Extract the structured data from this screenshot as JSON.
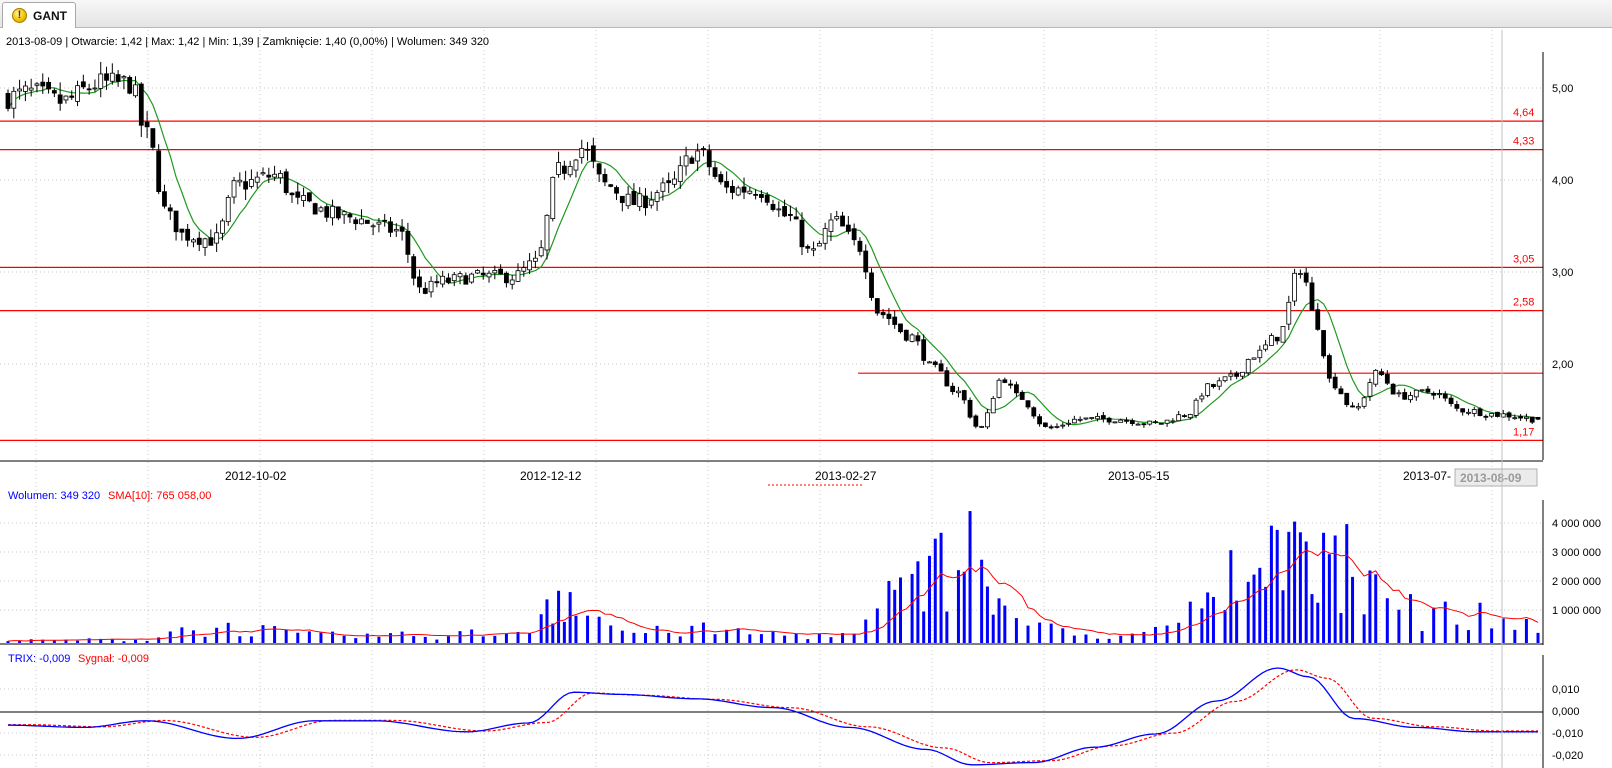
{
  "tab": {
    "label": "GANT",
    "icon": "warning-icon"
  },
  "colors": {
    "candle": "#000000",
    "ma": "#1f9a1f",
    "levels": "#ff0000",
    "volume": "#0000ff",
    "volume_sma": "#ff0000",
    "trix": "#0000ff",
    "signal": "#ff0000",
    "grid": "#c8c8c8"
  },
  "price_panel": {
    "info_line": "2013-08-09 | Otwarcie: 1,42 | Max: 1,42 | Min: 1,39 | Zamknięcie: 1,40 (0,00%)  | Wolumen: 349 320",
    "y_ticks": [
      "5,00",
      "4,00",
      "3,00",
      "2,00"
    ],
    "level_labels": [
      "4,64",
      "4,33",
      "3,05",
      "2,58",
      "1,17"
    ],
    "x_ticks": [
      "2012-10-02",
      "2012-12-12",
      "2013-02-27",
      "2013-05-15",
      "2013-07-"
    ],
    "cursor_date": "2013-08-09"
  },
  "volume_panel": {
    "legend_volume": "Wolumen: 349 320",
    "legend_sma": "SMA[10]: 765 058,00",
    "y_ticks": [
      "4 000 000",
      "3 000 000",
      "2 000 000",
      "1 000 000"
    ]
  },
  "trix_panel": {
    "legend_trix": "TRIX: -0,009",
    "legend_signal": "Sygnał: -0,009",
    "y_ticks": [
      "0,010",
      "0,000",
      "-0,010",
      "-0,020"
    ]
  },
  "chart_data": [
    {
      "type": "candlestick",
      "title": "",
      "x_range": [
        "2012-07",
        "2013-08-09"
      ],
      "ylim": [
        1.1,
        5.4
      ],
      "grid": true,
      "horizontal_levels": [
        4.64,
        4.33,
        3.05,
        2.58,
        1.9,
        1.17
      ],
      "last_candle": {
        "date": "2013-08-09",
        "open": 1.42,
        "high": 1.42,
        "low": 1.39,
        "close": 1.4,
        "change_pct": 0.0,
        "volume": 349320
      },
      "close_path": [
        {
          "t": 0.0,
          "v": 4.9
        },
        {
          "t": 0.015,
          "v": 4.95
        },
        {
          "t": 0.035,
          "v": 4.85
        },
        {
          "t": 0.06,
          "v": 5.05
        },
        {
          "t": 0.08,
          "v": 5.05
        },
        {
          "t": 0.09,
          "v": 4.5
        },
        {
          "t": 0.105,
          "v": 3.6
        },
        {
          "t": 0.115,
          "v": 3.4
        },
        {
          "t": 0.135,
          "v": 3.35
        },
        {
          "t": 0.15,
          "v": 3.95
        },
        {
          "t": 0.175,
          "v": 4.05
        },
        {
          "t": 0.19,
          "v": 3.75
        },
        {
          "t": 0.22,
          "v": 3.6
        },
        {
          "t": 0.255,
          "v": 3.45
        },
        {
          "t": 0.27,
          "v": 2.8
        },
        {
          "t": 0.285,
          "v": 2.9
        },
        {
          "t": 0.305,
          "v": 2.95
        },
        {
          "t": 0.33,
          "v": 2.95
        },
        {
          "t": 0.345,
          "v": 3.1
        },
        {
          "t": 0.36,
          "v": 4.1
        },
        {
          "t": 0.375,
          "v": 4.35
        },
        {
          "t": 0.39,
          "v": 3.95
        },
        {
          "t": 0.41,
          "v": 3.75
        },
        {
          "t": 0.43,
          "v": 3.9
        },
        {
          "t": 0.45,
          "v": 4.3
        },
        {
          "t": 0.47,
          "v": 3.9
        },
        {
          "t": 0.49,
          "v": 3.9
        },
        {
          "t": 0.51,
          "v": 3.6
        },
        {
          "t": 0.525,
          "v": 3.2
        },
        {
          "t": 0.54,
          "v": 3.55
        },
        {
          "t": 0.555,
          "v": 3.3
        },
        {
          "t": 0.57,
          "v": 2.55
        },
        {
          "t": 0.59,
          "v": 2.3
        },
        {
          "t": 0.605,
          "v": 1.95
        },
        {
          "t": 0.62,
          "v": 1.7
        },
        {
          "t": 0.635,
          "v": 1.3
        },
        {
          "t": 0.65,
          "v": 1.85
        },
        {
          "t": 0.66,
          "v": 1.65
        },
        {
          "t": 0.68,
          "v": 1.3
        },
        {
          "t": 0.7,
          "v": 1.4
        },
        {
          "t": 0.725,
          "v": 1.4
        },
        {
          "t": 0.75,
          "v": 1.35
        },
        {
          "t": 0.77,
          "v": 1.45
        },
        {
          "t": 0.785,
          "v": 1.75
        },
        {
          "t": 0.8,
          "v": 1.85
        },
        {
          "t": 0.815,
          "v": 2.1
        },
        {
          "t": 0.83,
          "v": 2.3
        },
        {
          "t": 0.845,
          "v": 3.05
        },
        {
          "t": 0.855,
          "v": 2.45
        },
        {
          "t": 0.865,
          "v": 1.8
        },
        {
          "t": 0.88,
          "v": 1.5
        },
        {
          "t": 0.895,
          "v": 1.9
        },
        {
          "t": 0.91,
          "v": 1.65
        },
        {
          "t": 0.93,
          "v": 1.7
        },
        {
          "t": 0.95,
          "v": 1.5
        },
        {
          "t": 0.975,
          "v": 1.45
        },
        {
          "t": 1.0,
          "v": 1.4
        }
      ]
    },
    {
      "type": "bar",
      "title": "",
      "series": [
        {
          "name": "Wolumen",
          "values_last": 349320
        },
        {
          "name": "SMA[10]",
          "values_last": 765058
        }
      ],
      "ylim": [
        0,
        4600000
      ],
      "volume_profile": [
        {
          "t": 0.0,
          "v": 80000
        },
        {
          "t": 0.09,
          "v": 120000
        },
        {
          "t": 0.11,
          "v": 450000
        },
        {
          "t": 0.15,
          "v": 500000
        },
        {
          "t": 0.2,
          "v": 250000
        },
        {
          "t": 0.26,
          "v": 250000
        },
        {
          "t": 0.33,
          "v": 350000
        },
        {
          "t": 0.36,
          "v": 1300000
        },
        {
          "t": 0.38,
          "v": 900000
        },
        {
          "t": 0.41,
          "v": 350000
        },
        {
          "t": 0.45,
          "v": 450000
        },
        {
          "t": 0.5,
          "v": 300000
        },
        {
          "t": 0.55,
          "v": 250000
        },
        {
          "t": 0.58,
          "v": 1500000
        },
        {
          "t": 0.61,
          "v": 2600000
        },
        {
          "t": 0.635,
          "v": 2000000
        },
        {
          "t": 0.66,
          "v": 800000
        },
        {
          "t": 0.7,
          "v": 250000
        },
        {
          "t": 0.74,
          "v": 300000
        },
        {
          "t": 0.76,
          "v": 450000
        },
        {
          "t": 0.78,
          "v": 1200000
        },
        {
          "t": 0.8,
          "v": 1400000
        },
        {
          "t": 0.83,
          "v": 2800000
        },
        {
          "t": 0.86,
          "v": 2500000
        },
        {
          "t": 0.89,
          "v": 2200000
        },
        {
          "t": 0.91,
          "v": 1500000
        },
        {
          "t": 0.93,
          "v": 900000
        },
        {
          "t": 0.95,
          "v": 1000000
        },
        {
          "t": 0.97,
          "v": 800000
        },
        {
          "t": 1.0,
          "v": 600000
        }
      ],
      "peaks": [
        {
          "t": 0.61,
          "v": 3800000
        },
        {
          "t": 0.63,
          "v": 4550000
        },
        {
          "t": 0.8,
          "v": 3200000
        },
        {
          "t": 0.83,
          "v": 3900000
        },
        {
          "t": 0.86,
          "v": 3800000
        },
        {
          "t": 0.875,
          "v": 4100000
        },
        {
          "t": 0.85,
          "v": 3500000
        },
        {
          "t": 0.89,
          "v": 2500000
        }
      ]
    },
    {
      "type": "line",
      "title": "",
      "series": [
        {
          "name": "TRIX",
          "last": -0.009
        },
        {
          "name": "Sygnał",
          "last": -0.009
        }
      ],
      "ylim": [
        -0.025,
        0.02
      ],
      "trix_path": [
        {
          "t": 0.0,
          "v": -0.006
        },
        {
          "t": 0.05,
          "v": -0.007
        },
        {
          "t": 0.09,
          "v": -0.004
        },
        {
          "t": 0.15,
          "v": -0.012
        },
        {
          "t": 0.2,
          "v": -0.004
        },
        {
          "t": 0.24,
          "v": -0.004
        },
        {
          "t": 0.3,
          "v": -0.009
        },
        {
          "t": 0.34,
          "v": -0.005
        },
        {
          "t": 0.37,
          "v": 0.009
        },
        {
          "t": 0.4,
          "v": 0.008
        },
        {
          "t": 0.45,
          "v": 0.006
        },
        {
          "t": 0.5,
          "v": 0.002
        },
        {
          "t": 0.55,
          "v": -0.007
        },
        {
          "t": 0.6,
          "v": -0.017
        },
        {
          "t": 0.63,
          "v": -0.024
        },
        {
          "t": 0.67,
          "v": -0.023
        },
        {
          "t": 0.71,
          "v": -0.016
        },
        {
          "t": 0.75,
          "v": -0.01
        },
        {
          "t": 0.79,
          "v": 0.005
        },
        {
          "t": 0.83,
          "v": 0.02
        },
        {
          "t": 0.85,
          "v": 0.016
        },
        {
          "t": 0.88,
          "v": -0.003
        },
        {
          "t": 0.92,
          "v": -0.007
        },
        {
          "t": 0.96,
          "v": -0.009
        },
        {
          "t": 1.0,
          "v": -0.009
        }
      ],
      "signal_lag": 0.012
    }
  ]
}
